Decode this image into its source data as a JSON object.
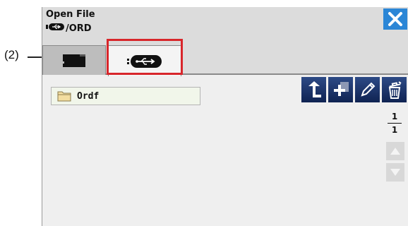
{
  "callout": {
    "label": "(2)",
    "color": "#d8262b"
  },
  "header": {
    "title": "Open File",
    "path_icon": "usb-drive-icon",
    "path_text": "/ORD",
    "close_icon": "close-x-icon",
    "accent": "#2b86d6"
  },
  "tabs": [
    {
      "icon": "internal-memory-icon",
      "selected": false
    },
    {
      "icon": "usb-drive-icon",
      "selected": true
    }
  ],
  "toolbar": [
    {
      "icon": "parent-folder-up-arrow-icon"
    },
    {
      "icon": "new-folder-plus-icon"
    },
    {
      "icon": "rename-pencil-icon"
    },
    {
      "icon": "delete-trash-icon"
    }
  ],
  "files": [
    {
      "name": "Ordf",
      "icon": "folder-icon"
    }
  ],
  "pagination": {
    "current": "1",
    "total": "1"
  },
  "scroll": {
    "up_icon": "triangle-up-icon",
    "down_icon": "triangle-down-icon"
  }
}
